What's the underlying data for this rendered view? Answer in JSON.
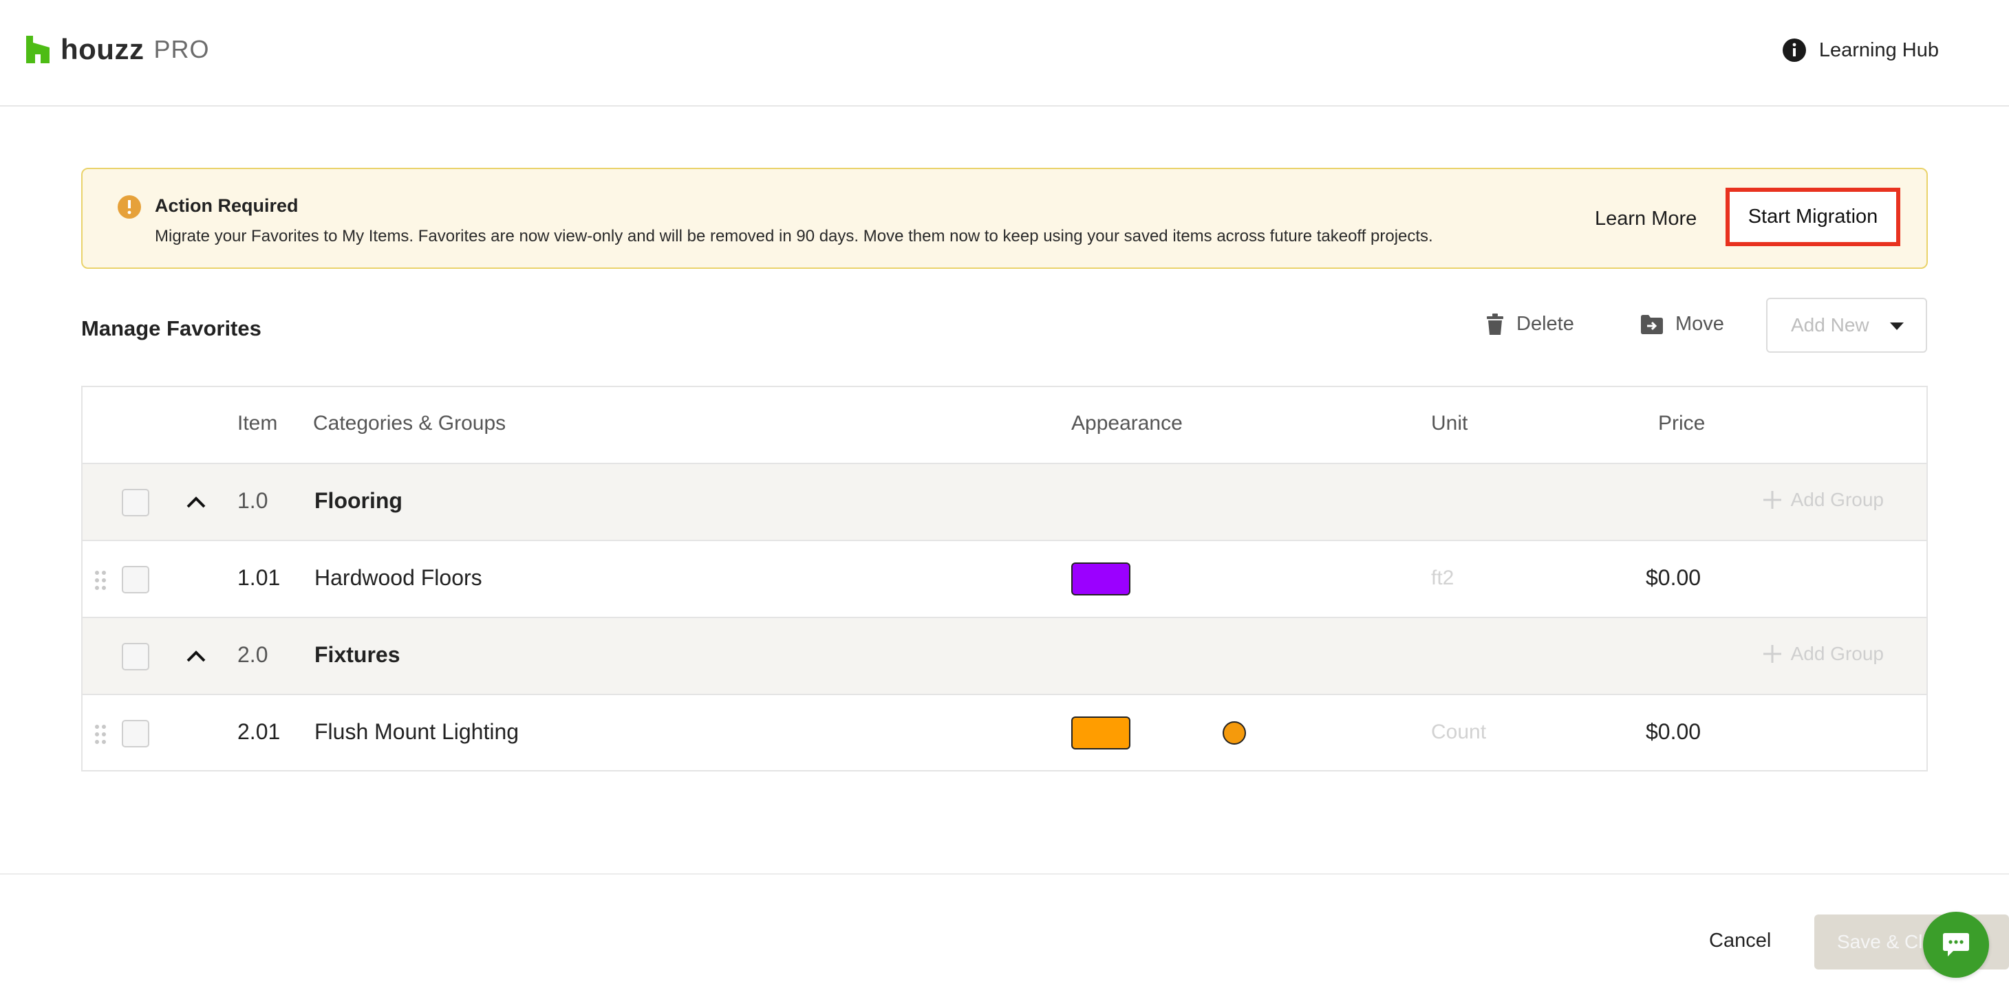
{
  "header": {
    "brand": "houzz",
    "brand_suffix": "PRO",
    "learning_hub": "Learning Hub"
  },
  "banner": {
    "title": "Action Required",
    "message": "Migrate your Favorites to My Items. Favorites are now view-only and will be removed in 90 days. Move them now to keep using your saved items across future takeoff projects.",
    "learn_more": "Learn More",
    "start_migration": "Start Migration"
  },
  "toolbar": {
    "title": "Manage Favorites",
    "delete": "Delete",
    "move": "Move",
    "add_new": "Add New"
  },
  "table": {
    "columns": [
      "Item",
      "Categories & Groups",
      "Appearance",
      "Unit",
      "Price"
    ],
    "rows": [
      {
        "type": "group",
        "number": "1.0",
        "name": "Flooring",
        "action": "Add Group"
      },
      {
        "type": "item",
        "number": "1.01",
        "name": "Hardwood Floors",
        "swatch_color": "#9b00ff",
        "unit": "ft2",
        "price": "$0.00"
      },
      {
        "type": "group",
        "number": "2.0",
        "name": "Fixtures",
        "action": "Add Group"
      },
      {
        "type": "item",
        "number": "2.01",
        "name": "Flush Mount Lighting",
        "swatch_color": "#ff9d00",
        "marker_color": "#f59a0c",
        "unit": "Count",
        "price": "$0.00"
      }
    ]
  },
  "footer": {
    "cancel": "Cancel",
    "save_close": "Save & Cl"
  },
  "colors": {
    "brand_green": "#4dbc15",
    "banner_bg": "#fdf7e6",
    "highlight_red": "#e8321f",
    "chat_green": "#3b9e2a"
  }
}
